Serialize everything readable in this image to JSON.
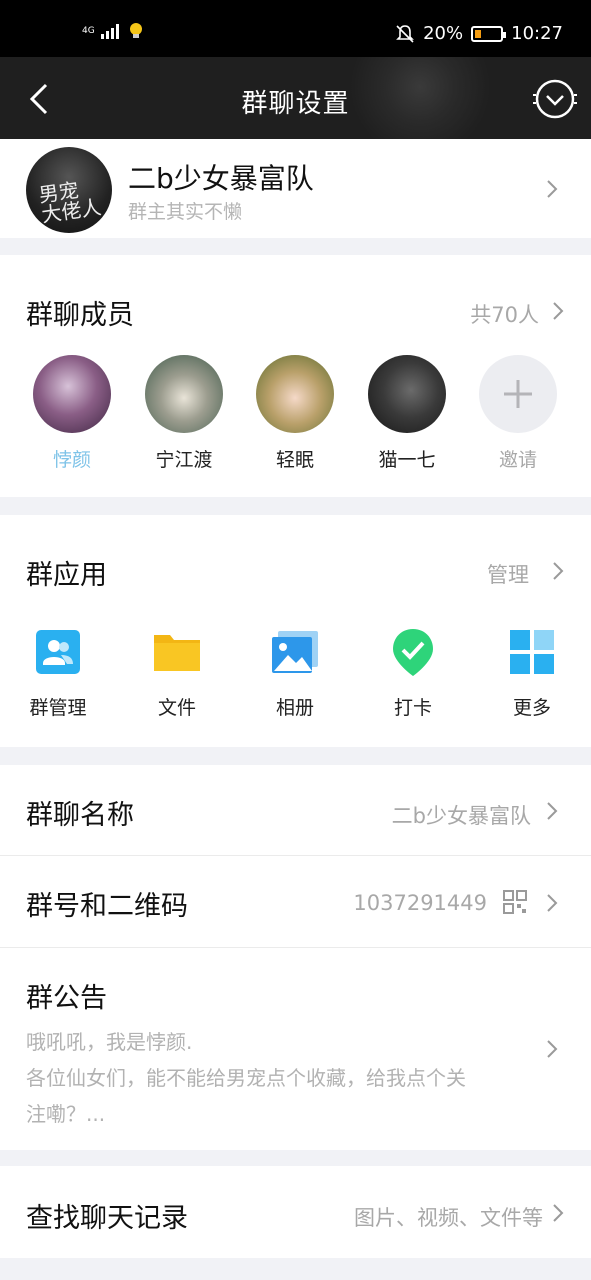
{
  "status_bar": {
    "network": "4G",
    "battery_percent": "20%",
    "time": "10:27"
  },
  "nav": {
    "title": "群聊设置"
  },
  "group": {
    "name": "二b少女暴富队",
    "owner": "群主其实不懒"
  },
  "members": {
    "title": "群聊成员",
    "count_text": "共70人",
    "items": [
      {
        "name": "悖颜"
      },
      {
        "name": "宁江渡"
      },
      {
        "name": "轻眠"
      },
      {
        "name": "猫一七"
      },
      {
        "name": "邀请"
      }
    ]
  },
  "apps": {
    "title": "群应用",
    "manage_label": "管理",
    "items": [
      {
        "label": "群管理",
        "icon": "group-manage-icon"
      },
      {
        "label": "文件",
        "icon": "folder-icon"
      },
      {
        "label": "相册",
        "icon": "album-icon"
      },
      {
        "label": "打卡",
        "icon": "checkin-icon"
      },
      {
        "label": "更多",
        "icon": "more-grid-icon"
      }
    ]
  },
  "settings": {
    "group_name_label": "群聊名称",
    "group_name_value": "二b少女暴富队",
    "group_id_label": "群号和二维码",
    "group_id_value": "1037291449",
    "notice_label": "群公告",
    "notice_lines": [
      "哦吼吼，我是悖颜.",
      "各位仙女们，能不能给男宠点个收藏，给我点个关",
      "注嘞？..."
    ]
  },
  "search": {
    "label": "查找聊天记录",
    "hint": "图片、视频、文件等"
  },
  "colors": {
    "accent_blue": "#7ec3e8",
    "folder_yellow": "#f9c623",
    "checkin_green": "#2ed47a",
    "app_blue": "#2ab0f0"
  }
}
